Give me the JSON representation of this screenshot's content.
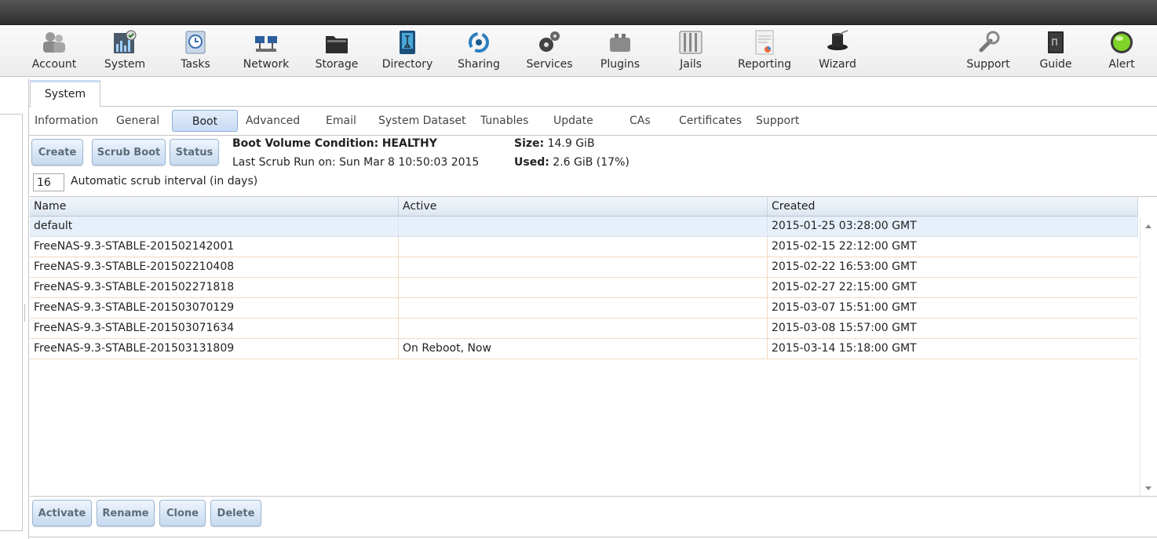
{
  "toolbar": {
    "items": [
      {
        "label": "Account",
        "icon": "account-icon"
      },
      {
        "label": "System",
        "icon": "system-icon"
      },
      {
        "label": "Tasks",
        "icon": "tasks-icon"
      },
      {
        "label": "Network",
        "icon": "network-icon"
      },
      {
        "label": "Storage",
        "icon": "storage-icon"
      },
      {
        "label": "Directory",
        "icon": "directory-icon"
      },
      {
        "label": "Sharing",
        "icon": "sharing-icon"
      },
      {
        "label": "Services",
        "icon": "services-icon"
      },
      {
        "label": "Plugins",
        "icon": "plugins-icon"
      },
      {
        "label": "Jails",
        "icon": "jails-icon"
      },
      {
        "label": "Reporting",
        "icon": "reporting-icon"
      },
      {
        "label": "Wizard",
        "icon": "wizard-icon"
      },
      {
        "label": "Support",
        "icon": "support-icon"
      },
      {
        "label": "Guide",
        "icon": "guide-icon"
      },
      {
        "label": "Alert",
        "icon": "alert-icon"
      }
    ]
  },
  "main_tab": {
    "label": "System"
  },
  "subtabs": [
    "Information",
    "General",
    "Boot",
    "Advanced",
    "Email",
    "System Dataset",
    "Tunables",
    "Update",
    "CAs",
    "Certificates",
    "Support"
  ],
  "active_subtab": "Boot",
  "boot": {
    "buttons": {
      "create": "Create",
      "scrub_boot": "Scrub Boot",
      "status": "Status"
    },
    "condition_label": "Boot Volume Condition:",
    "condition_value": "HEALTHY",
    "scrub_run_label": "Last Scrub Run on:",
    "scrub_run_value": "Sun Mar 8 10:50:03 2015",
    "size_label": "Size:",
    "size_value": "14.9 GiB",
    "used_label": "Used:",
    "used_value": "2.6 GiB (17%)",
    "scrub_interval_value": "16",
    "scrub_interval_label": "Automatic scrub interval (in days)"
  },
  "grid": {
    "columns": [
      "Name",
      "Active",
      "Created"
    ],
    "rows": [
      {
        "name": "default",
        "active": "",
        "created": "2015-01-25 03:28:00 GMT"
      },
      {
        "name": "FreeNAS-9.3-STABLE-201502142001",
        "active": "",
        "created": "2015-02-15 22:12:00 GMT"
      },
      {
        "name": "FreeNAS-9.3-STABLE-201502210408",
        "active": "",
        "created": "2015-02-22 16:53:00 GMT"
      },
      {
        "name": "FreeNAS-9.3-STABLE-201502271818",
        "active": "",
        "created": "2015-02-27 22:15:00 GMT"
      },
      {
        "name": "FreeNAS-9.3-STABLE-201503070129",
        "active": "",
        "created": "2015-03-07 15:51:00 GMT"
      },
      {
        "name": "FreeNAS-9.3-STABLE-201503071634",
        "active": "",
        "created": "2015-03-08 15:57:00 GMT"
      },
      {
        "name": "FreeNAS-9.3-STABLE-201503131809",
        "active": "On Reboot, Now",
        "created": "2015-03-14 15:18:00 GMT"
      }
    ]
  },
  "actions": {
    "activate": "Activate",
    "rename": "Rename",
    "clone": "Clone",
    "delete": "Delete"
  }
}
